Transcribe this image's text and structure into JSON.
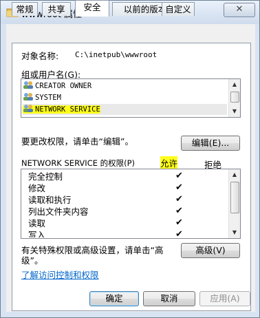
{
  "window": {
    "title": "wwwroot 属性",
    "close_label": "✕"
  },
  "tabs": [
    {
      "label": "常规",
      "active": false
    },
    {
      "label": "共享",
      "active": false
    },
    {
      "label": "安全",
      "active": true
    },
    {
      "label": "以前的版本",
      "active": false
    },
    {
      "label": "自定义",
      "active": false
    }
  ],
  "object": {
    "label": "对象名称:",
    "value": "C:\\inetpub\\wwwroot"
  },
  "groups": {
    "label": "组或用户名(G):",
    "items": [
      {
        "name": "CREATOR OWNER",
        "selected": false
      },
      {
        "name": "SYSTEM",
        "selected": false
      },
      {
        "name": "NETWORK SERVICE",
        "selected": true
      }
    ]
  },
  "edit_prompt": "要更改权限，请单击“编辑”。",
  "edit_button": "编辑(E)...",
  "permissions": {
    "header": "NETWORK SERVICE 的权限(P)",
    "allow_label": "允许",
    "deny_label": "拒绝",
    "rows": [
      {
        "name": "完全控制",
        "allow": "✔"
      },
      {
        "name": "修改",
        "allow": "✔"
      },
      {
        "name": "读取和执行",
        "allow": "✔"
      },
      {
        "name": "列出文件夹内容",
        "allow": "✔"
      },
      {
        "name": "读取",
        "allow": "✔"
      },
      {
        "name": "写入",
        "allow": "✔"
      }
    ]
  },
  "advanced": {
    "prompt_line1": "有关特殊权限或高级设置，请单击“高",
    "prompt_line2": "级”。",
    "button": "高级(V)"
  },
  "link": "了解访问控制和权限",
  "footer": {
    "ok": "确定",
    "cancel": "取消",
    "apply": "应用(A)"
  },
  "colors": {
    "highlight": "#ffff1a",
    "link": "#0066cc"
  }
}
